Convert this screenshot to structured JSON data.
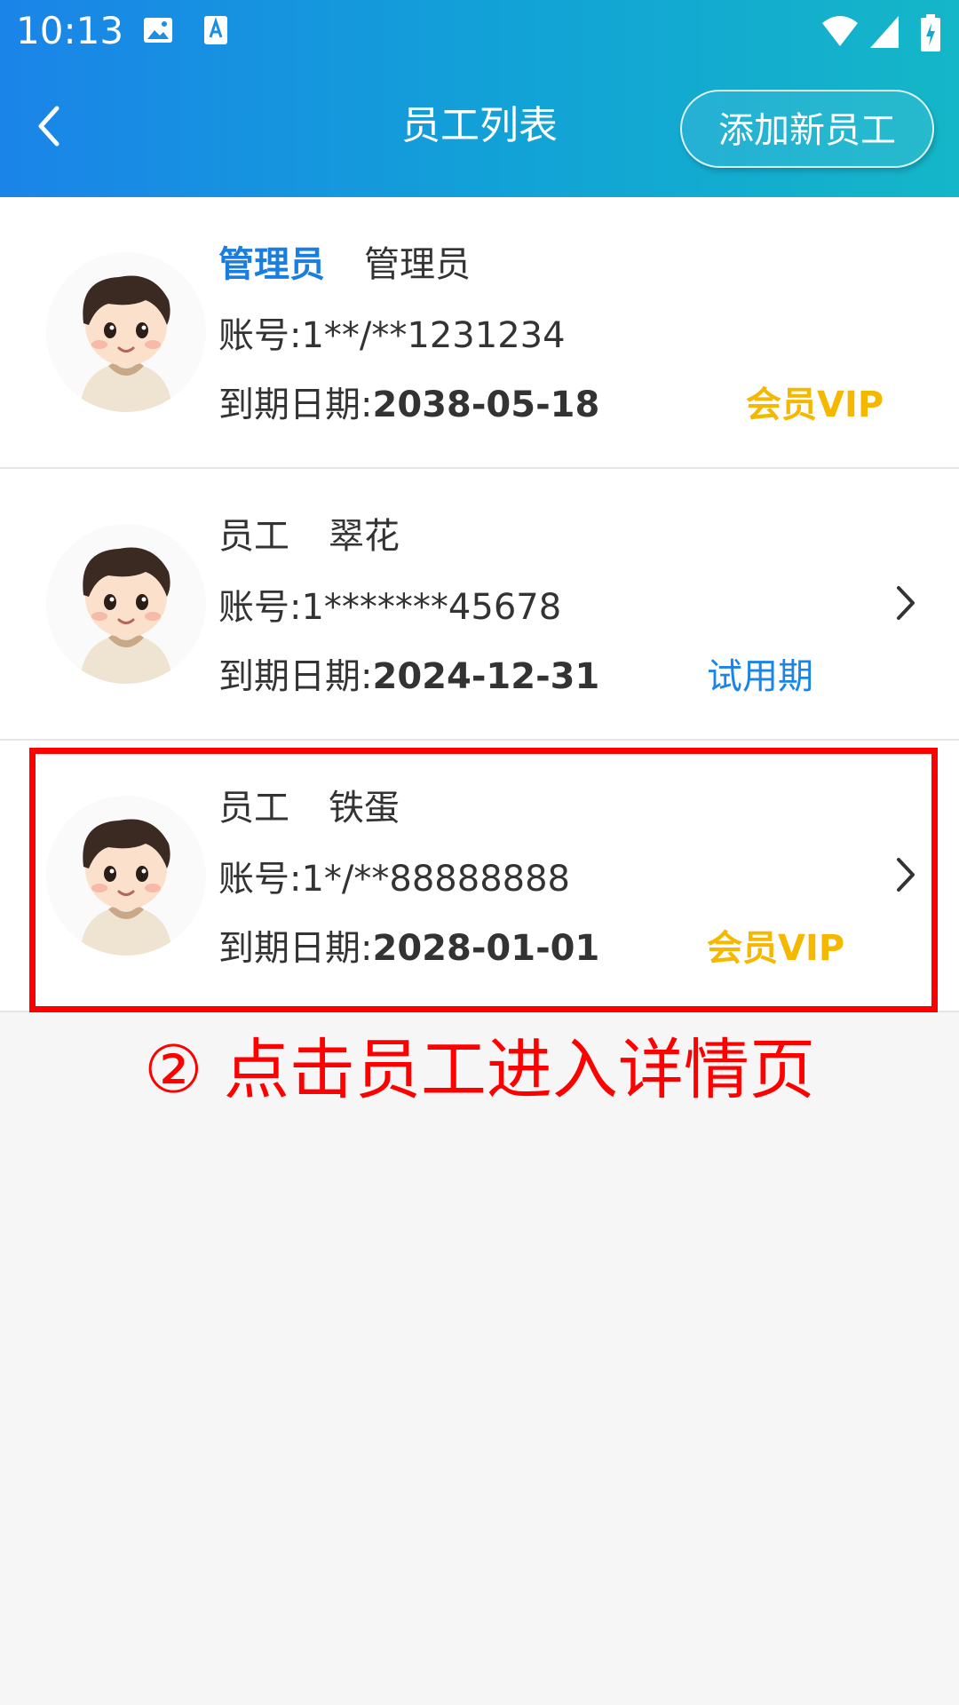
{
  "status_bar": {
    "time": "10:13"
  },
  "navbar": {
    "title": "员工列表",
    "add_button": "添加新员工"
  },
  "employees": [
    {
      "role": "管理员",
      "name": "管理员",
      "account": "账号:1**/**1231234",
      "expiry_label": "到期日期:",
      "expiry_date": "2038-05-18",
      "badge": "会员VIP"
    },
    {
      "role": "员工",
      "name": "翠花",
      "account": "账号:1*******45678",
      "expiry_label": "到期日期:",
      "expiry_date": "2024-12-31",
      "badge": "试用期"
    },
    {
      "role": "员工",
      "name": "铁蛋",
      "account": "账号:1*/**88888888",
      "expiry_label": "到期日期:",
      "expiry_date": "2028-01-01",
      "badge": "会员VIP"
    }
  ],
  "annotation": "② 点击员工进入详情页",
  "colors": {
    "header_start": "#1a84e8",
    "header_end": "#14b6c8",
    "vip": "#f5b800",
    "trial": "#1a84e8",
    "admin": "#1a7ee0",
    "highlight": "#ff0000"
  }
}
